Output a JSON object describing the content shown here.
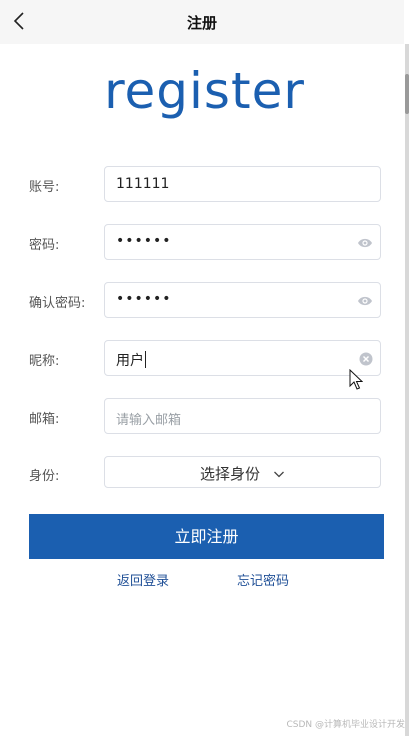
{
  "header": {
    "title": "注册"
  },
  "logo_text": "register",
  "form": {
    "account": {
      "label": "账号:",
      "value": "111111"
    },
    "password": {
      "label": "密码:",
      "value": "••••••"
    },
    "confirm_password": {
      "label": "确认密码:",
      "value": "••••••"
    },
    "nickname": {
      "label": "昵称:",
      "value": "用户"
    },
    "email": {
      "label": "邮箱:",
      "placeholder": "请输入邮箱"
    },
    "identity": {
      "label": "身份:",
      "selected": "选择身份"
    }
  },
  "submit_label": "立即注册",
  "links": {
    "back_login": "返回登录",
    "forgot_password": "忘记密码"
  },
  "watermark": "CSDN @计算机毕业设计开发",
  "colors": {
    "primary": "#1b5fb0",
    "link": "#1f4f96"
  }
}
